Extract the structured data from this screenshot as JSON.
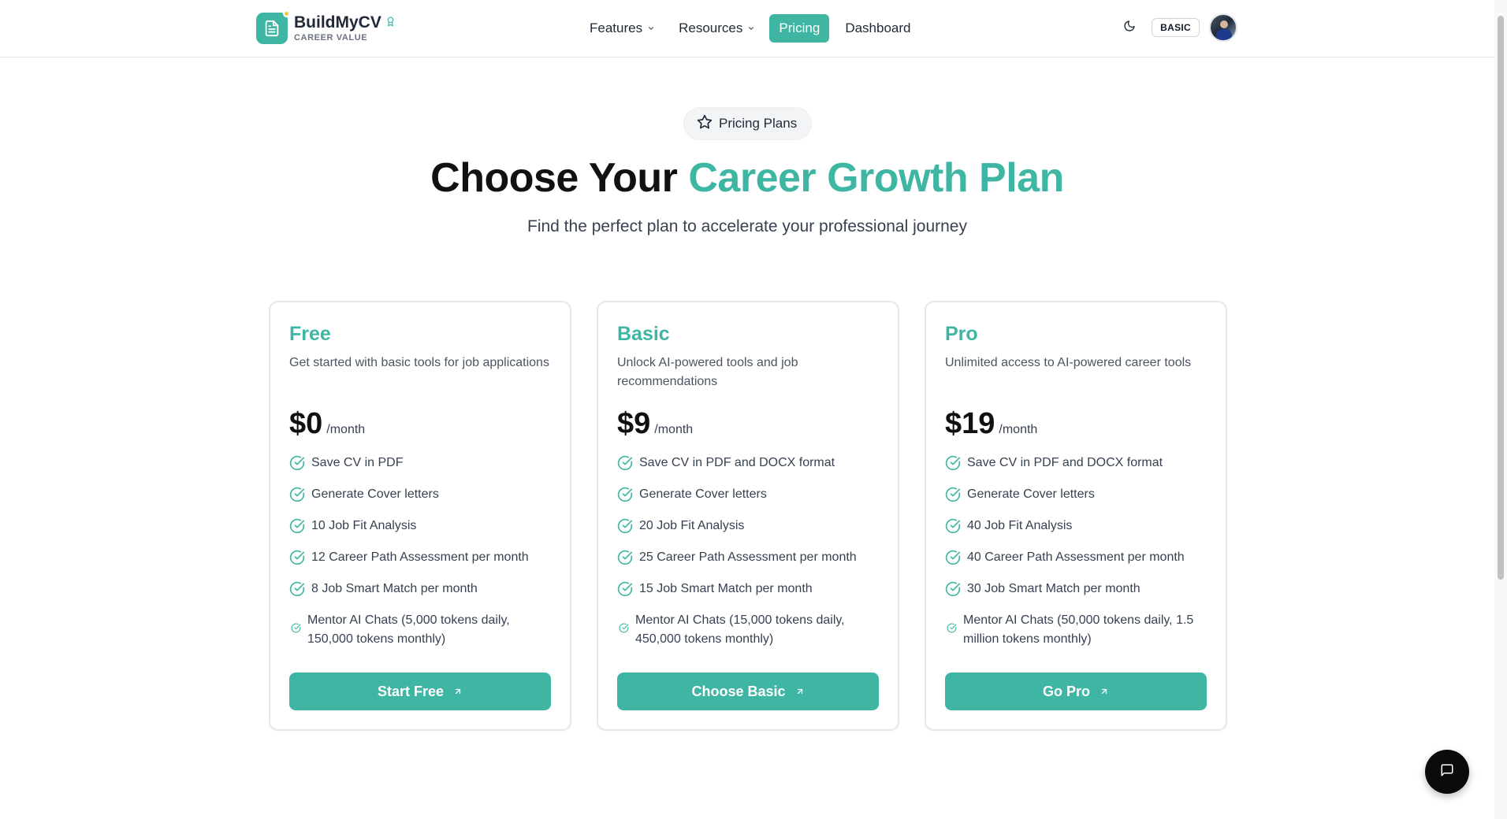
{
  "brand": {
    "name": "BuildMyCV",
    "tagline": "CAREER VALUE",
    "logo_icon": "document-icon",
    "badge_icon": "award-icon",
    "accent": "#3fb5a3"
  },
  "nav": {
    "items": [
      {
        "label": "Features",
        "dropdown": true,
        "active": false
      },
      {
        "label": "Resources",
        "dropdown": true,
        "active": false
      },
      {
        "label": "Pricing",
        "dropdown": false,
        "active": true
      },
      {
        "label": "Dashboard",
        "dropdown": false,
        "active": false
      }
    ]
  },
  "header_tools": {
    "theme_icon": "moon-icon",
    "plan_badge": "BASIC",
    "avatar": "user-avatar"
  },
  "hero": {
    "pill_label": "Pricing Plans",
    "pill_icon": "star-icon",
    "title_prefix": "Choose Your ",
    "title_accent": "Career Growth Plan",
    "subtitle": "Find the perfect plan to accelerate your professional journey"
  },
  "plans": [
    {
      "name": "Free",
      "description": "Get started with basic tools for job applications",
      "price": "$0",
      "period": "/month",
      "features": [
        "Save CV in PDF",
        "Generate Cover letters",
        "10 Job Fit Analysis",
        "12 Career Path Assessment per month",
        "8 Job Smart Match per month",
        "Mentor AI Chats (5,000 tokens daily, 150,000 tokens monthly)"
      ],
      "cta": "Start Free"
    },
    {
      "name": "Basic",
      "description": "Unlock AI-powered tools and job recommendations",
      "price": "$9",
      "period": "/month",
      "features": [
        "Save CV in PDF and DOCX format",
        "Generate Cover letters",
        "20 Job Fit Analysis",
        "25 Career Path Assessment per month",
        "15 Job Smart Match per month",
        "Mentor AI Chats (15,000 tokens daily, 450,000 tokens monthly)"
      ],
      "cta": "Choose Basic"
    },
    {
      "name": "Pro",
      "description": "Unlimited access to AI-powered career tools",
      "price": "$19",
      "period": "/month",
      "features": [
        "Save CV in PDF and DOCX format",
        "Generate Cover letters",
        "40 Job Fit Analysis",
        "40 Career Path Assessment per month",
        "30 Job Smart Match per month",
        "Mentor AI Chats (50,000 tokens daily, 1.5 million tokens monthly)"
      ],
      "cta": "Go Pro"
    }
  ],
  "chat_fab": {
    "icon": "chat-bubble-icon"
  }
}
